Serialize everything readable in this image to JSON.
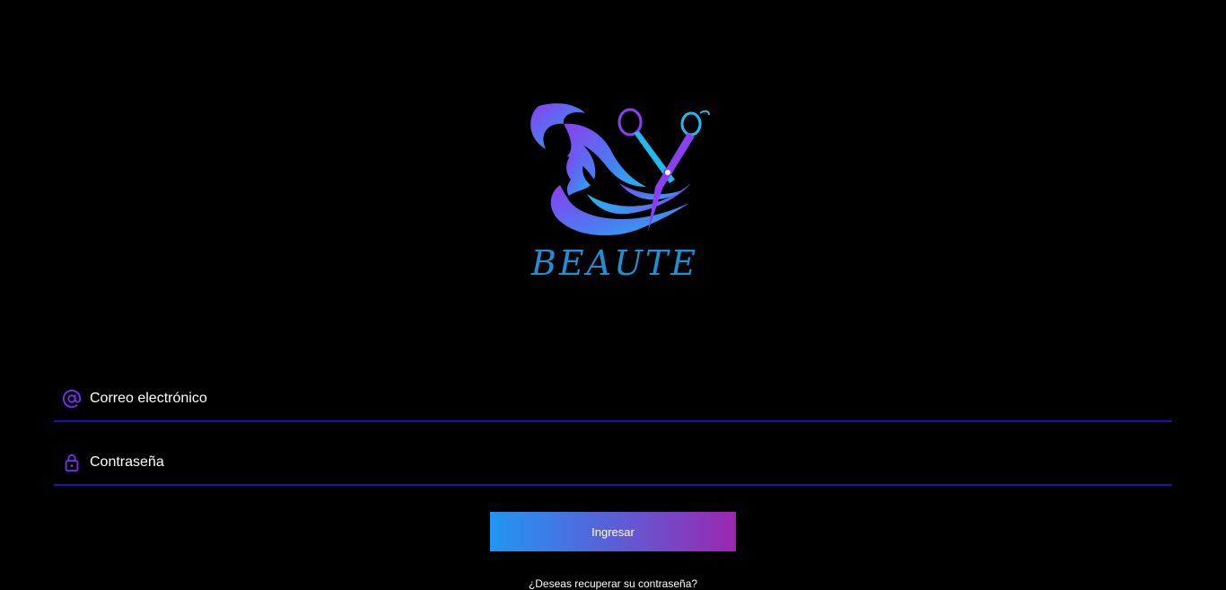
{
  "brand": {
    "logo_text": "BEAUTE",
    "colors": {
      "purple": "#8a3ff0",
      "blue": "#1e90d6",
      "cyan": "#22b8f0"
    }
  },
  "login": {
    "email": {
      "placeholder": "Correo electrónico",
      "value": "",
      "icon": "at-icon"
    },
    "password": {
      "placeholder": "Contraseña",
      "value": "",
      "icon": "lock-icon"
    },
    "submit_label": "Ingresar",
    "recover_label": "¿Deseas recuperar su contraseña?"
  },
  "theme": {
    "background": "#000000",
    "underline": "#1c16a8",
    "icon_color": "#7b2ff0",
    "button_gradient": [
      "#2196f3",
      "#9c27b0"
    ]
  }
}
